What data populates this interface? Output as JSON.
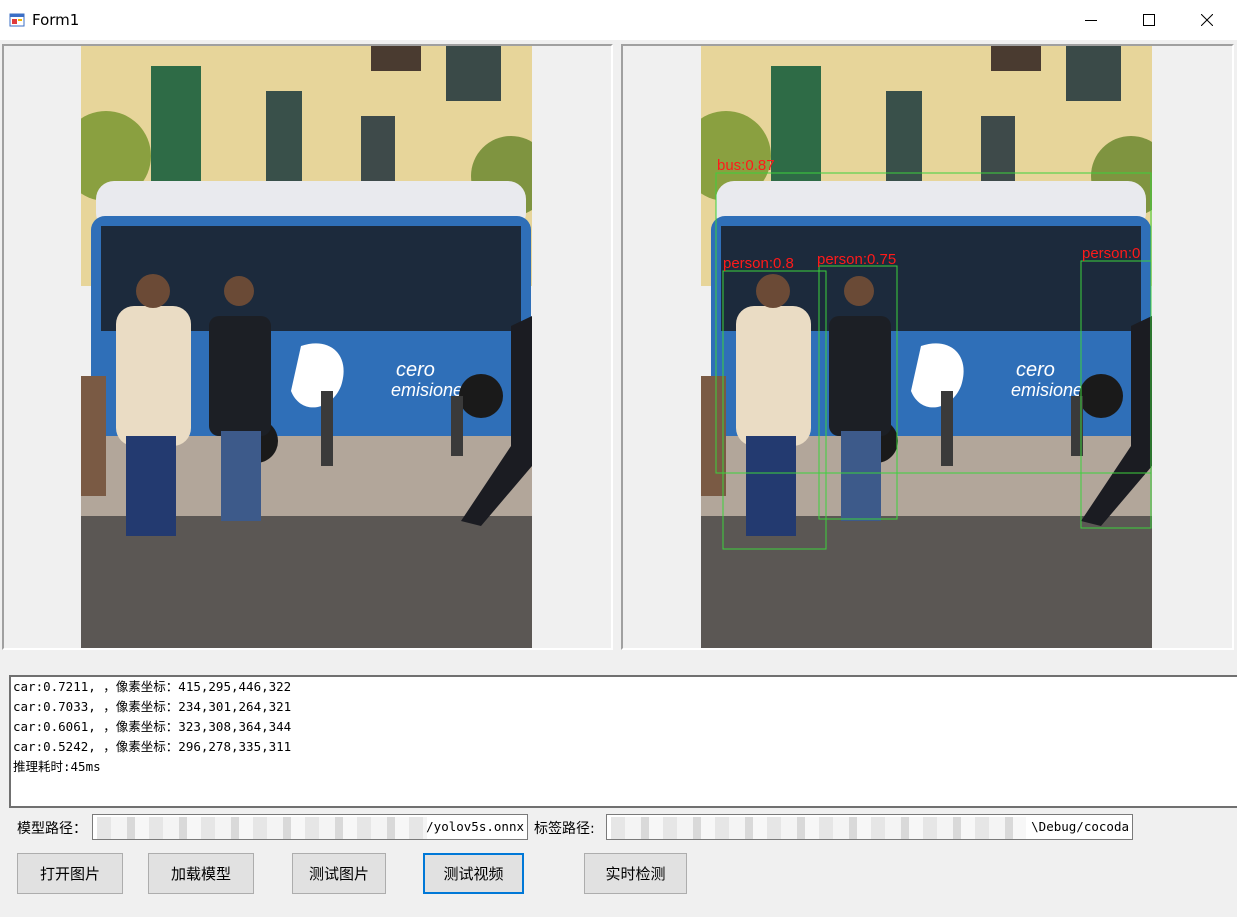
{
  "window": {
    "title": "Form1",
    "minimize_icon": "minimize-icon",
    "maximize_icon": "maximize-icon",
    "close_icon": "close-icon"
  },
  "detections": [
    {
      "label": "bus:0.87"
    },
    {
      "label": "person:0.8"
    },
    {
      "label": "person:0.75"
    },
    {
      "label": "person:0"
    }
  ],
  "output": {
    "lines": [
      "car:0.7211, ，像素坐标：415,295,446,322",
      "car:0.7033, ，像素坐标：234,301,264,321",
      "car:0.6061, ，像素坐标：323,308,364,344",
      "car:0.5242, ，像素坐标：296,278,335,311",
      "推理耗时:45ms"
    ]
  },
  "paths": {
    "model_label": "模型路径：",
    "model_value": "/yolov5s.onnx",
    "labels_label": "标签路径:",
    "labels_value": "\\Debug/cocoda"
  },
  "buttons": {
    "open_image": "打开图片",
    "load_model": "加载模型",
    "test_image": "测试图片",
    "test_video": "测试视频",
    "realtime": "实时检测"
  },
  "colors": {
    "box": "#3cd13c",
    "label": "#ff1a1a",
    "accent": "#0078d7"
  }
}
